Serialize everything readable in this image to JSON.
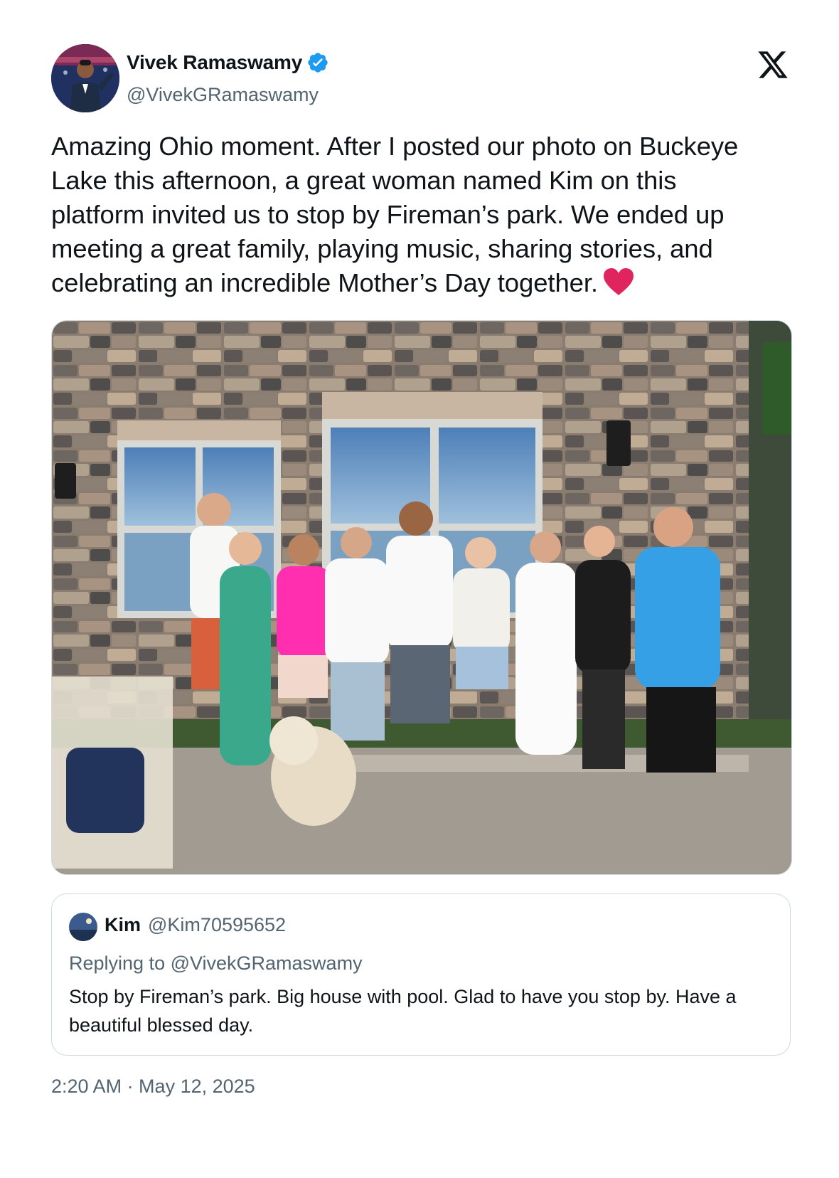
{
  "author": {
    "display_name": "Vivek Ramaswamy",
    "handle": "@VivekGRamaswamy",
    "verified": true
  },
  "brand": {
    "logo": "x-logo-icon"
  },
  "tweet": {
    "text": "Amazing Ohio moment. After I posted our photo on Buckeye Lake this afternoon, a great woman named Kim on this platform invited us to stop by Fireman’s park. We ended up meeting a great family, playing music, sharing stories, and celebrating an incredible Mother’s Day together.",
    "emoji": "heart-icon"
  },
  "quoted_tweet": {
    "display_name": "Kim",
    "handle": "@Kim70595652",
    "replying_to": "Replying to @VivekGRamaswamy",
    "text": "Stop by Fireman’s park. Big house with pool. Glad to have you stop by. Have a beautiful blessed day."
  },
  "timestamp": "2:20 AM · May 12, 2025",
  "colors": {
    "verified": "#1d9bf0",
    "heart": "#e0245e",
    "secondary_text": "#536471",
    "border": "#cfd9de"
  }
}
